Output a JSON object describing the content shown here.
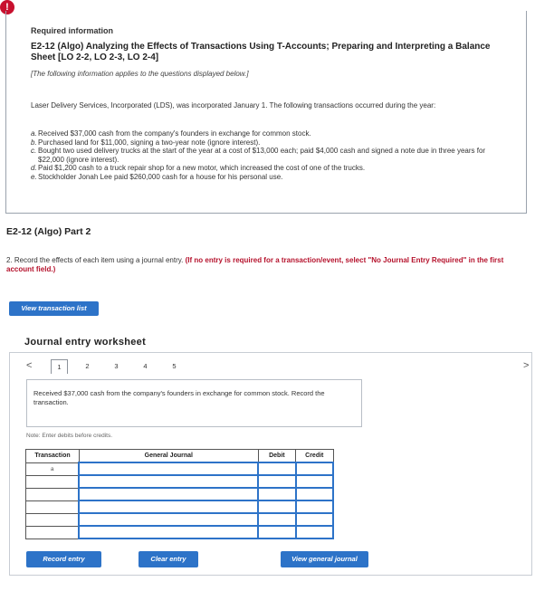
{
  "alert_icon_glyph": "!",
  "required_info": {
    "heading": "Required information",
    "problem_title": "E2-12 (Algo) Analyzing the Effects of Transactions Using T-Accounts; Preparing and Interpreting a Balance Sheet [LO 2-2, LO 2-3, LO 2-4]",
    "applies_note": "[The following information applies to the questions displayed below.]",
    "intro": "Laser Delivery Services, Incorporated (LDS), was incorporated January 1. The following transactions occurred during the year:",
    "transactions": [
      {
        "letter": "a.",
        "text": "Received $37,000 cash from the company's founders in exchange for common stock."
      },
      {
        "letter": "b.",
        "text": "Purchased land for $11,000, signing a two-year note (ignore interest)."
      },
      {
        "letter": "c.",
        "text": "Bought two used delivery trucks at the start of the year at a cost of $13,000 each; paid $4,000 cash and signed a note due in three years for $22,000 (ignore interest)."
      },
      {
        "letter": "d.",
        "text": "Paid $1,200 cash to a truck repair shop for a new motor, which increased the cost of one of the trucks."
      },
      {
        "letter": "e.",
        "text": "Stockholder Jonah Lee paid $260,000 cash for a house for his personal use."
      }
    ]
  },
  "part": {
    "title": "E2-12 (Algo) Part 2",
    "instruction_number": "2.",
    "instruction_text": "Record the effects of each item using a journal entry.",
    "instruction_red": "(If no entry is required for a transaction/event, select \"No Journal Entry Required\" in the first account field.)"
  },
  "buttons": {
    "view_transaction_list": "View transaction list",
    "record_entry": "Record entry",
    "clear_entry": "Clear entry",
    "view_general_journal": "View general journal"
  },
  "worksheet": {
    "title": "Journal entry worksheet",
    "prev_arrow": "<",
    "next_arrow": ">",
    "pages": [
      "1",
      "2",
      "3",
      "4",
      "5"
    ],
    "active_page": "1",
    "description": "Received $37,000 cash from the company's founders in exchange for common stock. Record the transaction.",
    "note": "Note: Enter debits before credits.",
    "columns": {
      "transaction": "Transaction",
      "general_journal": "General Journal",
      "debit": "Debit",
      "credit": "Credit"
    },
    "rows": [
      {
        "transaction": "a",
        "account": "",
        "debit": "",
        "credit": ""
      },
      {
        "transaction": "",
        "account": "",
        "debit": "",
        "credit": ""
      },
      {
        "transaction": "",
        "account": "",
        "debit": "",
        "credit": ""
      },
      {
        "transaction": "",
        "account": "",
        "debit": "",
        "credit": ""
      },
      {
        "transaction": "",
        "account": "",
        "debit": "",
        "credit": ""
      },
      {
        "transaction": "",
        "account": "",
        "debit": "",
        "credit": ""
      }
    ]
  },
  "colors": {
    "accent_blue": "#2d73c8",
    "alert_red": "#c8102e",
    "instruction_red": "#b5122c"
  }
}
